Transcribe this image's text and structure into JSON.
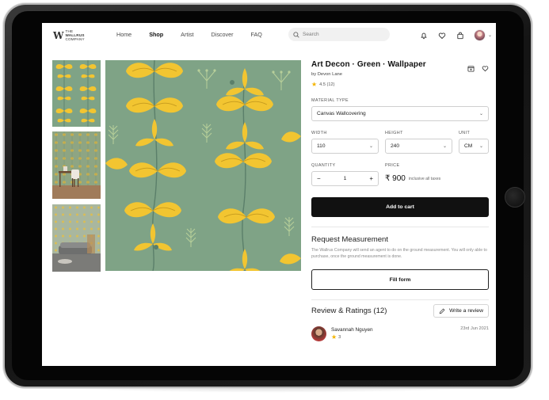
{
  "nav": {
    "logo": {
      "mark": "W",
      "line1": "THE",
      "line2": "WALLRUS",
      "line3": "COMPANY"
    },
    "links": [
      "Home",
      "Shop",
      "Artist",
      "Discover",
      "FAQ"
    ],
    "active_link": "Shop",
    "search_placeholder": "Search",
    "icons": [
      "bell-icon",
      "heart-icon",
      "bag-icon",
      "avatar",
      "chevron-down-icon"
    ]
  },
  "product": {
    "title": "Art Decon · Green · Wallpaper",
    "byline": "by Devon Lane",
    "rating": "4.5 (12)",
    "material_label": "MATERIAL TYPE",
    "material_value": "Canvas Wallcovering",
    "width_label": "WIDTH",
    "width_value": "110",
    "height_label": "HEIGHT",
    "height_value": "240",
    "unit_label": "UNIT",
    "unit_value": "CM",
    "quantity_label": "QUANTITY",
    "quantity_value": "1",
    "price_label": "PRICE",
    "price_value": "₹ 900",
    "price_note": "inclusive all taxes",
    "add_to_cart": "Add to cart"
  },
  "measurement": {
    "heading": "Request Measurement",
    "description": "The Wallrus Company will send an agent to do on the ground measurement. You will only able to purchase, once the ground measurement is done.",
    "button": "Fill form"
  },
  "reviews": {
    "heading": "Review & Ratings (12)",
    "write_button": "Write a review",
    "items": [
      {
        "name": "Savannah Nguyen",
        "date": "23rd Jun 2021",
        "rating": "3"
      }
    ]
  },
  "colors": {
    "wallpaper_bg": "#7fa386",
    "wallpaper_flower": "#f2c531",
    "wallpaper_stem": "#5b7f6a",
    "button_dark": "#111111",
    "star": "#f4b400"
  }
}
